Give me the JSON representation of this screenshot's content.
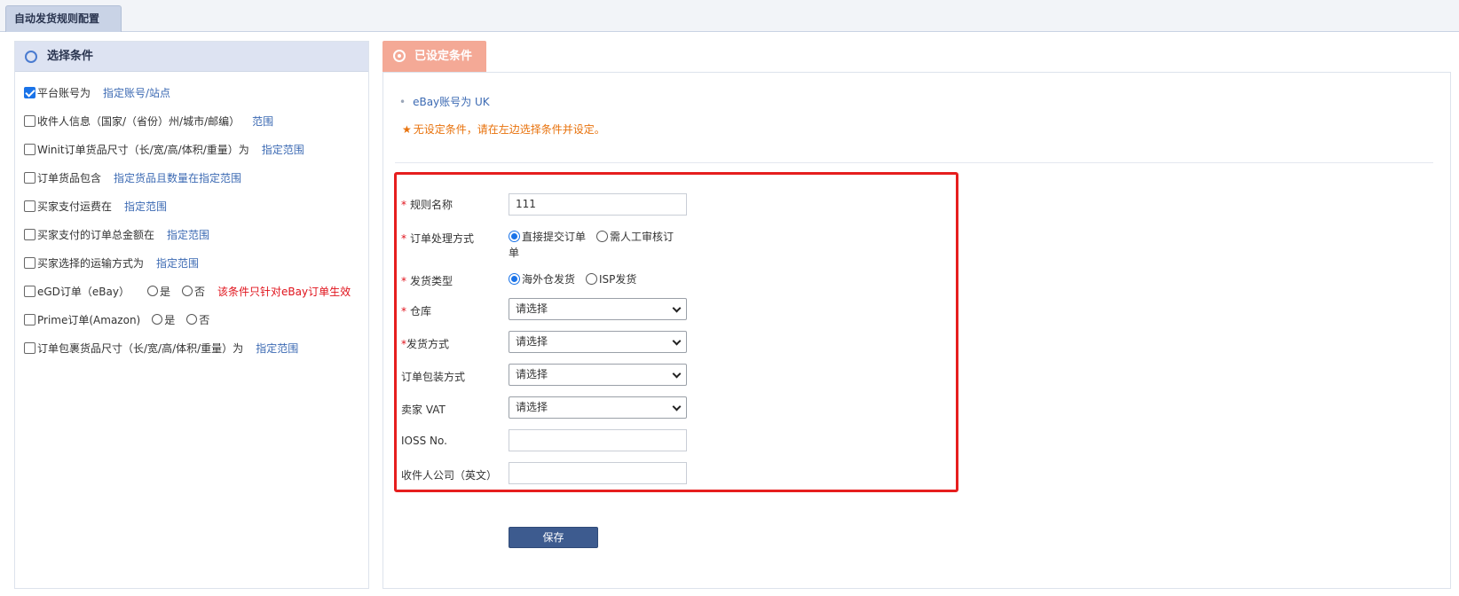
{
  "page_tab": {
    "label": "自动发货规则配置"
  },
  "left_panel": {
    "title": "选择条件",
    "conditions": [
      {
        "label": "平台账号为",
        "checked": true,
        "link": "指定账号/站点"
      },
      {
        "label": "收件人信息（国家/（省份）州/城市/邮编）",
        "checked": false,
        "link": "范围"
      },
      {
        "label": "Winit订单货品尺寸（长/宽/高/体积/重量）为",
        "checked": false,
        "link": "指定范围"
      },
      {
        "label": "订单货品包含",
        "checked": false,
        "link": "指定货品且数量在指定范围"
      },
      {
        "label": "买家支付运费在",
        "checked": false,
        "link": "指定范围"
      },
      {
        "label": "买家支付的订单总金额在",
        "checked": false,
        "link": "指定范围"
      },
      {
        "label": "买家选择的运输方式为",
        "checked": false,
        "link": "指定范围"
      },
      {
        "label": "eGD订单（eBay）",
        "checked": false,
        "yes": "是",
        "no": "否",
        "warning": "该条件只针对eBay订单生效"
      },
      {
        "label": "Prime订单(Amazon)",
        "checked": false,
        "yes": "是",
        "no": "否"
      },
      {
        "label": "订单包裹货品尺寸（长/宽/高/体积/重量）为",
        "checked": false,
        "link": "指定范围"
      }
    ]
  },
  "right_panel": {
    "tab_label": "已设定条件",
    "set_condition": "eBay账号为 UK",
    "notice": "无设定条件，请在左边选择条件并设定。",
    "form": {
      "rule_name": {
        "label": "规则名称",
        "required": "*",
        "value": "111"
      },
      "order_process": {
        "label": "订单处理方式",
        "required": "*",
        "option_direct": "直接提交订单",
        "option_review_line1": "需人工审核订",
        "option_review_line2": "单",
        "selected": "直接提交订单"
      },
      "ship_type": {
        "label": "发货类型",
        "required": "*",
        "option_overseas": "海外仓发货",
        "option_isp": "ISP发货",
        "selected": "海外仓发货"
      },
      "warehouse": {
        "label": "仓库",
        "required": "*",
        "value": "请选择"
      },
      "ship_method": {
        "label": "发货方式",
        "required": "*",
        "value": "请选择"
      },
      "package_method": {
        "label": "订单包装方式",
        "value": "请选择"
      },
      "seller_vat": {
        "label": "卖家 VAT",
        "value": "请选择"
      },
      "ioss": {
        "label": "IOSS No.",
        "value": ""
      },
      "recipient_company": {
        "label": "收件人公司（英文）",
        "value": ""
      }
    },
    "save_label": "保存"
  },
  "colors": {
    "accent": "#3c6ab3",
    "tab_salmon": "#f4a996",
    "highlight_border": "#e61e1e",
    "warning": "#e0121b",
    "notice": "#e8720c",
    "save_button": "#3d5b8f"
  },
  "icons": {
    "left_header": "circle-icon",
    "right_tab": "target-icon",
    "notice": "star-icon",
    "select": "chevron-down-icon"
  }
}
